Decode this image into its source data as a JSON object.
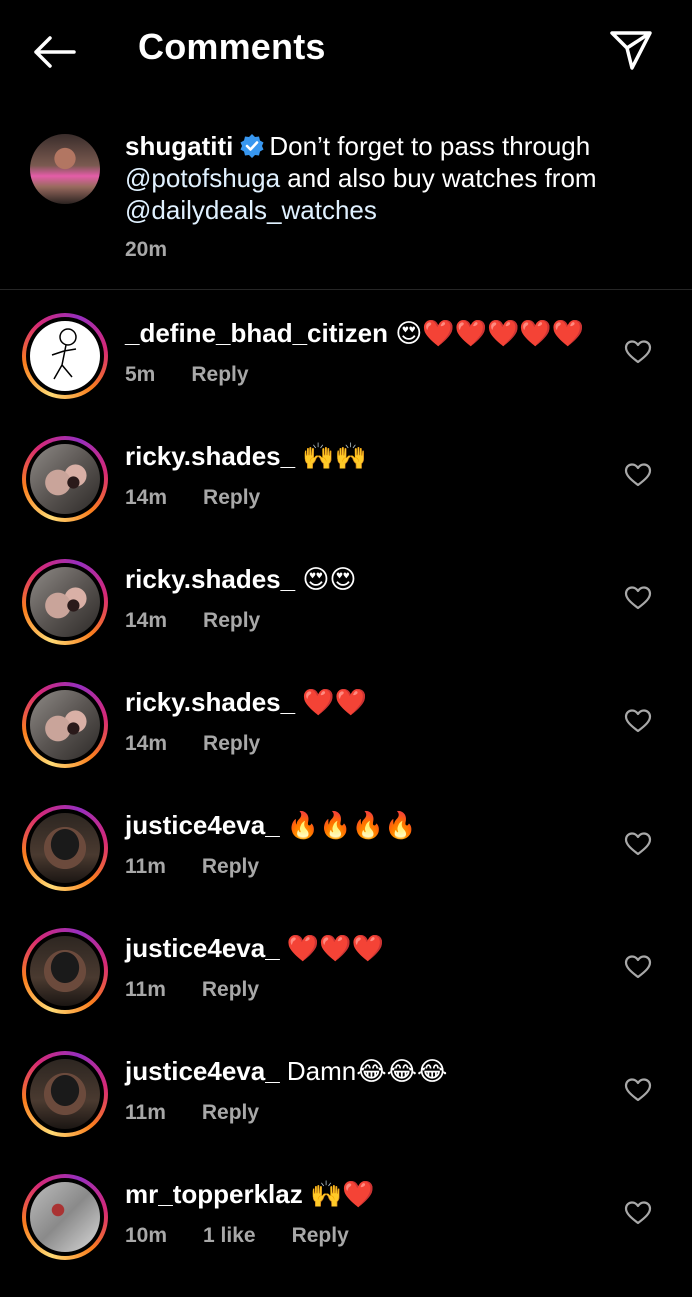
{
  "header": {
    "title": "Comments"
  },
  "caption": {
    "username": "shugatiti",
    "text_before": "Don’t forget to pass through",
    "mention1": "@potofshuga",
    "text_middle": "and also buy watches from",
    "mention2": "@dailydeals_watches",
    "time": "20m"
  },
  "comments": [
    {
      "username": "_define_bhad_citizen",
      "text": "😍❤️❤️❤️❤️❤️",
      "time": "5m",
      "likes": "",
      "reply": "Reply"
    },
    {
      "username": "ricky.shades_",
      "text": "🙌🙌",
      "time": "14m",
      "likes": "",
      "reply": "Reply"
    },
    {
      "username": "ricky.shades_",
      "text": "😍😍",
      "time": "14m",
      "likes": "",
      "reply": "Reply"
    },
    {
      "username": "ricky.shades_",
      "text": "❤️❤️",
      "time": "14m",
      "likes": "",
      "reply": "Reply"
    },
    {
      "username": "justice4eva_",
      "text": "🔥🔥🔥🔥",
      "time": "11m",
      "likes": "",
      "reply": "Reply"
    },
    {
      "username": "justice4eva_",
      "text": "❤️❤️❤️",
      "time": "11m",
      "likes": "",
      "reply": "Reply"
    },
    {
      "username": "justice4eva_",
      "text": "Damn😂😂😂",
      "time": "11m",
      "likes": "",
      "reply": "Reply"
    },
    {
      "username": "mr_topperklaz",
      "text": "🙌❤️",
      "time": "10m",
      "likes": "1 like",
      "reply": "Reply"
    }
  ],
  "icons": {
    "back": "arrow-left-icon",
    "share": "send-icon",
    "verified": "verified-badge-icon",
    "like": "heart-icon"
  },
  "colors": {
    "background": "#000000",
    "secondary_text": "#a8a8a8",
    "verified_blue": "#3897f0"
  }
}
